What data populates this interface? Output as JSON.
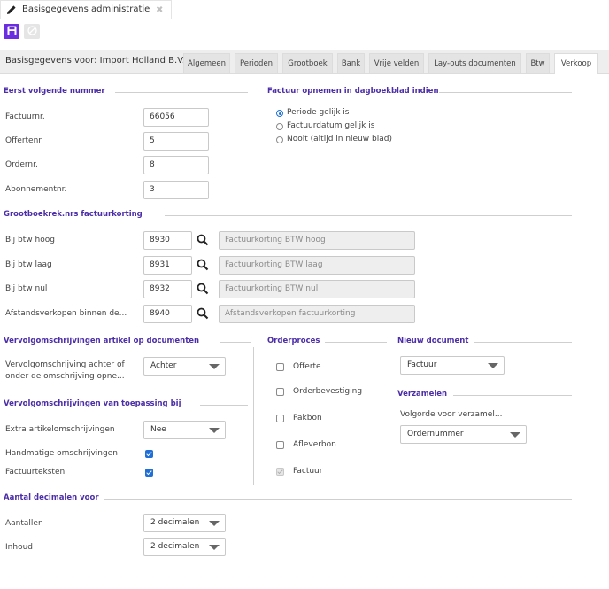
{
  "window": {
    "tab_title": "Basisgegevens administratie",
    "close_glyph": "✖"
  },
  "toolbar": {
    "save_icon": "save-icon",
    "cancel_icon": "cancel-icon"
  },
  "header": {
    "title": "Basisgegevens voor: Import Holland B.V.",
    "tabs": [
      "Algemeen",
      "Perioden",
      "Grootboek",
      "Bank",
      "Vrije velden",
      "Lay-outs documenten",
      "Btw",
      "Verkoop"
    ],
    "active_tab": "Verkoop"
  },
  "numbers": {
    "heading": "Eerst volgende nummer",
    "factuur_label": "Factuurnr.",
    "factuur_value": "66056",
    "offerte_label": "Offertenr.",
    "offerte_value": "5",
    "order_label": "Ordernr.",
    "order_value": "8",
    "abonnement_label": "Abonnementnr.",
    "abonnement_value": "3"
  },
  "dagboek": {
    "heading": "Factuur opnemen in dagboekblad indien",
    "options": [
      "Periode gelijk is",
      "Factuurdatum gelijk is",
      "Nooit (altijd in nieuw blad)"
    ],
    "selected": "Periode gelijk is"
  },
  "korting": {
    "heading": "Grootboekrek.nrs factuurkorting",
    "rows": [
      {
        "label": "Bij btw hoog",
        "code": "8930",
        "description": "Factuurkorting BTW hoog"
      },
      {
        "label": "Bij btw laag",
        "code": "8931",
        "description": "Factuurkorting BTW laag"
      },
      {
        "label": "Bij btw nul",
        "code": "8932",
        "description": "Factuurkorting BTW nul"
      },
      {
        "label": "Afstandsverkopen binnen de...",
        "code": "8940",
        "description": "Afstandsverkopen factuurkorting"
      }
    ]
  },
  "vervolg_doc": {
    "heading": "Vervolgomschrijvingen artikel op documenten",
    "label_line1": "Vervolgomschrijving achter of",
    "label_line2": "onder de omschrijving opne...",
    "value": "Achter"
  },
  "vervolg_toep": {
    "heading": "Vervolgomschrijvingen van toepassing bij",
    "extra_label": "Extra artikelomschrijvingen",
    "extra_value": "Nee",
    "handmatig_label": "Handmatige omschrijvingen",
    "handmatig_checked": true,
    "factuur_label": "Factuurteksten",
    "factuur_checked": true
  },
  "orderproces": {
    "heading": "Orderproces",
    "items": [
      {
        "label": "Offerte",
        "checked": false
      },
      {
        "label": "Orderbevestiging",
        "checked": false
      },
      {
        "label": "Pakbon",
        "checked": false
      },
      {
        "label": "Afleverbon",
        "checked": false
      },
      {
        "label": "Factuur",
        "checked": true,
        "disabled": true
      }
    ]
  },
  "nieuw_document": {
    "heading": "Nieuw document",
    "value": "Factuur"
  },
  "verzamelen": {
    "heading": "Verzamelen",
    "label": "Volgorde voor verzamel...",
    "value": "Ordernummer"
  },
  "decimalen": {
    "heading": "Aantal decimalen voor",
    "aantallen_label": "Aantallen",
    "aantallen_value": "2 decimalen",
    "inhoud_label": "Inhoud",
    "inhoud_value": "2 decimalen"
  },
  "colors": {
    "accent": "#6b2de0",
    "heading": "#4c2fa8",
    "check": "#1f6fd6"
  }
}
